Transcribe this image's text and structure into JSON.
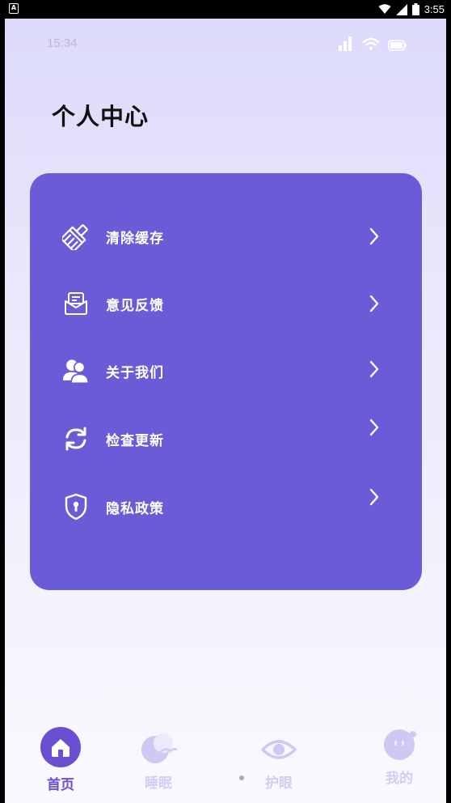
{
  "system_status": {
    "badge": "A",
    "time": "3:55"
  },
  "app_status": {
    "time": "15:34"
  },
  "page": {
    "title": "个人中心"
  },
  "menu": [
    {
      "label": "清除缓存",
      "icon": "broom-icon"
    },
    {
      "label": "意见反馈",
      "icon": "feedback-icon"
    },
    {
      "label": "关于我们",
      "icon": "users-icon"
    },
    {
      "label": "检查更新",
      "icon": "refresh-icon"
    },
    {
      "label": "隐私政策",
      "icon": "shield-icon"
    }
  ],
  "tabs": [
    {
      "label": "首页",
      "icon": "home-icon",
      "active": true
    },
    {
      "label": "睡眠",
      "icon": "moon-icon",
      "active": false
    },
    {
      "label": "护眼",
      "icon": "eye-icon",
      "active": false
    },
    {
      "label": "我的",
      "icon": "face-icon",
      "active": false
    }
  ],
  "colors": {
    "card": "#6a5bd6",
    "tab_active": "#6a4fd0",
    "tab_inactive": "#cfc8f3"
  }
}
